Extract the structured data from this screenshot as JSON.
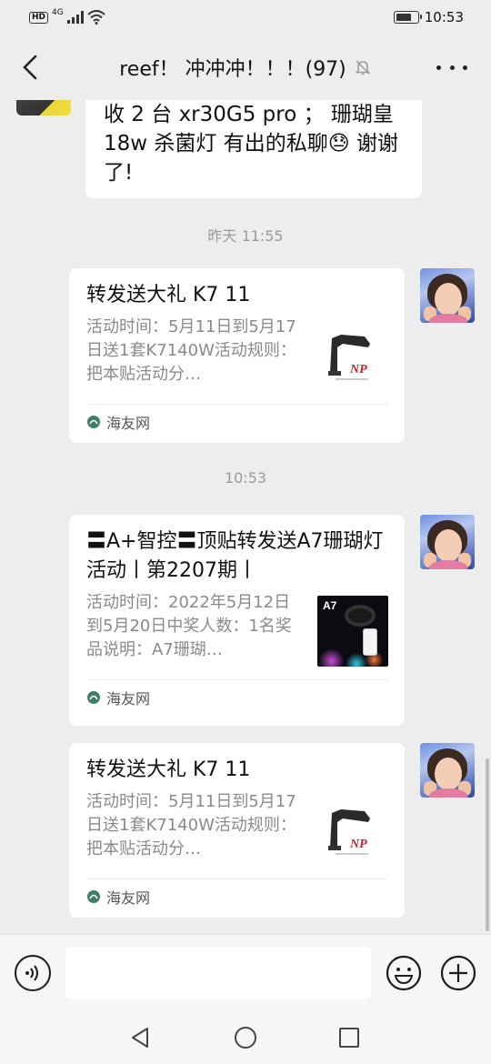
{
  "status_bar": {
    "hd": "HD",
    "network": "4G",
    "time": "10:53",
    "battery_level": 0.75
  },
  "header": {
    "title": "reef！ 冲冲冲！！！(97)",
    "muted_icon": "bell-off-icon"
  },
  "messages": {
    "partial_text": "收 2 台 xr30G5 pro ； 珊瑚皇18w 杀菌灯 有出的私聊😓 谢谢了!",
    "timestamp_1": "昨天 11:55",
    "timestamp_2": "10:53",
    "cards": [
      {
        "title": "转发送大礼 K7 11",
        "desc": "活动时间：5月11日到5月17日送1套K7140W活动规则：把本贴活动分…",
        "source": "海友网",
        "thumb": "k7-lamp"
      },
      {
        "title": "〓A+智控〓顶贴转发送A7珊瑚灯活动丨第2207期丨",
        "desc": "活动时间：2022年5月12日到5月20日中奖人数：1名奖品说明：A7珊瑚…",
        "source": "海友网",
        "thumb": "a7-lamp",
        "thumb_label": "A7"
      },
      {
        "title": "转发送大礼 K7 11",
        "desc": "活动时间：5月11日到5月17日送1套K7140W活动规则：把本贴活动分…",
        "source": "海友网",
        "thumb": "k7-lamp"
      }
    ]
  },
  "input_bar": {
    "placeholder": "",
    "voice_icon": "voice-icon",
    "emoji_icon": "emoji-icon",
    "plus_icon": "plus-icon"
  },
  "colors": {
    "background": "#ededed",
    "bubble": "#ffffff",
    "timestamp": "#9a9a9a",
    "desc_text": "#8a8a8a"
  }
}
